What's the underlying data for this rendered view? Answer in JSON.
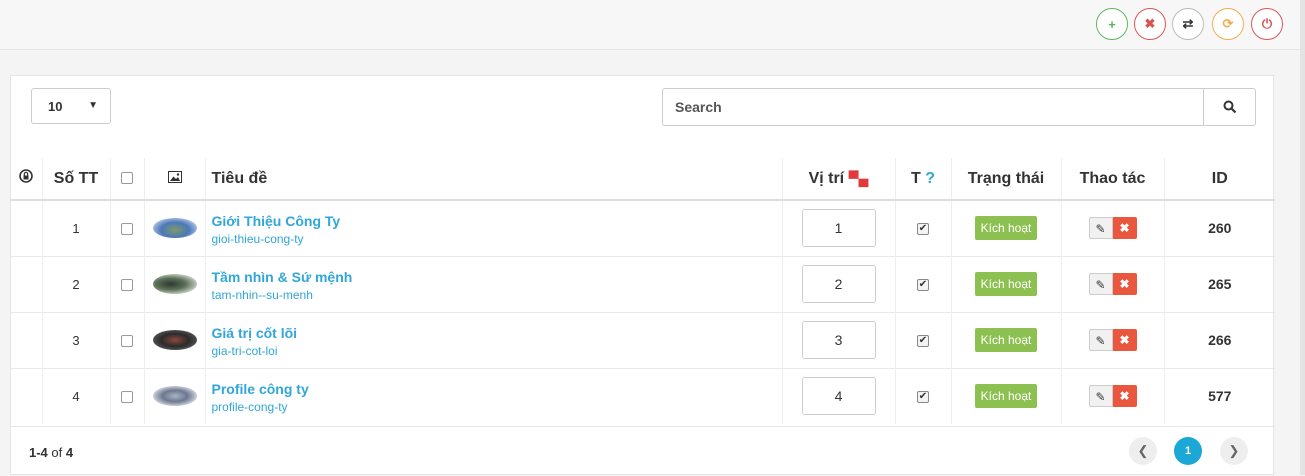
{
  "toolbar": {
    "add": "+",
    "delete": "✖",
    "swap": "⇄",
    "refresh": "⟳",
    "power": "⏻"
  },
  "controls": {
    "page_size": "10",
    "search_placeholder": "Search"
  },
  "columns": {
    "lock": "",
    "stt": "Số TT",
    "check": "",
    "image": "",
    "title": "Tiêu đề",
    "position": "Vị trí",
    "t": "T",
    "t_help": "?",
    "status": "Trạng thái",
    "actions": "Thao tác",
    "id": "ID"
  },
  "rows": [
    {
      "stt": "1",
      "title": "Giới Thiệu Công Ty",
      "slug": "gioi-thieu-cong-ty",
      "position": "1",
      "status": "Kích hoạt",
      "id": "260"
    },
    {
      "stt": "2",
      "title": "Tầm nhìn & Sứ mệnh",
      "slug": "tam-nhin--su-menh",
      "position": "2",
      "status": "Kích hoạt",
      "id": "265"
    },
    {
      "stt": "3",
      "title": "Giá trị cốt lõi",
      "slug": "gia-tri-cot-loi",
      "position": "3",
      "status": "Kích hoạt",
      "id": "266"
    },
    {
      "stt": "4",
      "title": "Profile công ty",
      "slug": "profile-cong-ty",
      "position": "4",
      "status": "Kích hoạt",
      "id": "577"
    }
  ],
  "footer": {
    "range": "1-4",
    "of": "of",
    "total": "4",
    "current_page": "1"
  },
  "colors": {
    "accent": "#1ba8d6",
    "status": "#8cc152",
    "danger": "#e9573f"
  }
}
